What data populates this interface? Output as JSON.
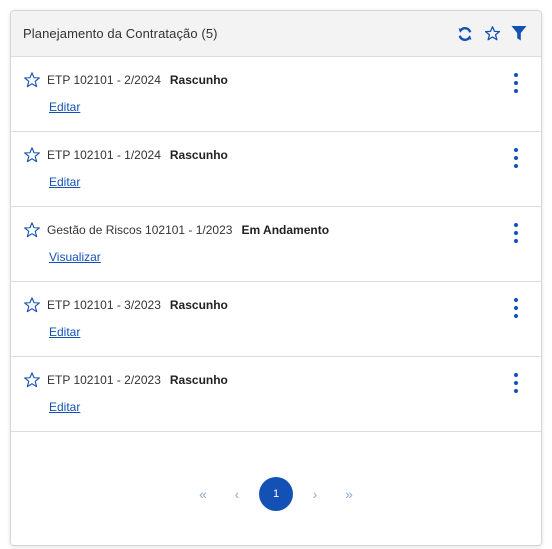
{
  "header": {
    "title": "Planejamento da Contratação (5)",
    "icons": [
      "refresh-icon",
      "star-outline-icon",
      "filter-icon"
    ]
  },
  "colors": {
    "accent": "#1351b4",
    "header_bg": "#f3f3f3",
    "divider": "#d4dde6"
  },
  "items": [
    {
      "name": "ETP 102101 - 2/2024",
      "status": "Rascunho",
      "action": "Editar"
    },
    {
      "name": "ETP 102101 - 1/2024",
      "status": "Rascunho",
      "action": "Editar"
    },
    {
      "name": "Gestão de Riscos 102101 - 1/2023",
      "status": "Em Andamento",
      "action": "Visualizar"
    },
    {
      "name": "ETP 102101 - 3/2023",
      "status": "Rascunho",
      "action": "Editar"
    },
    {
      "name": "ETP 102101 - 2/2023",
      "status": "Rascunho",
      "action": "Editar"
    }
  ],
  "pagination": {
    "first": "«",
    "prev": "‹",
    "current": "1",
    "next": "›",
    "last": "»"
  }
}
